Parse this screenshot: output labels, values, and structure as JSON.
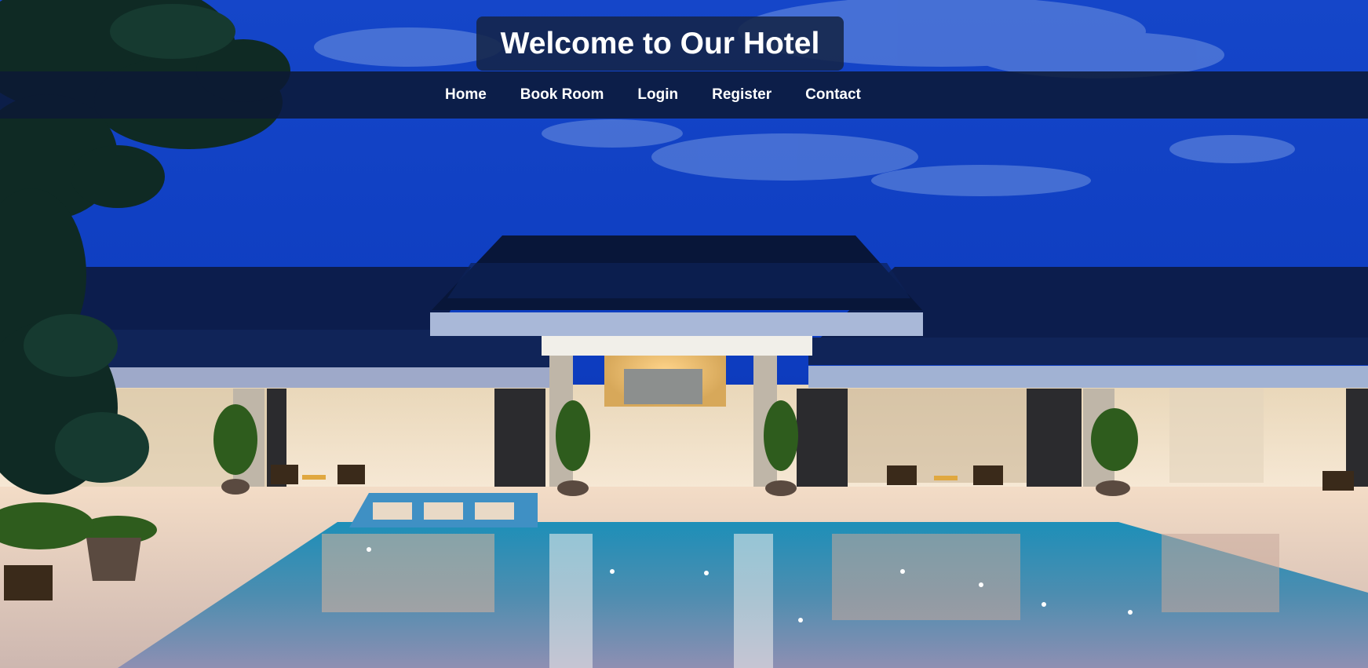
{
  "header": {
    "title": "Welcome to Our Hotel"
  },
  "nav": {
    "items": [
      {
        "label": "Home"
      },
      {
        "label": "Book Room"
      },
      {
        "label": "Login"
      },
      {
        "label": "Register"
      },
      {
        "label": "Contact"
      }
    ]
  },
  "colors": {
    "sky": "#0b2f9e",
    "nav_background": "#0c1834",
    "title_background": "#142448",
    "text": "#ffffff"
  }
}
